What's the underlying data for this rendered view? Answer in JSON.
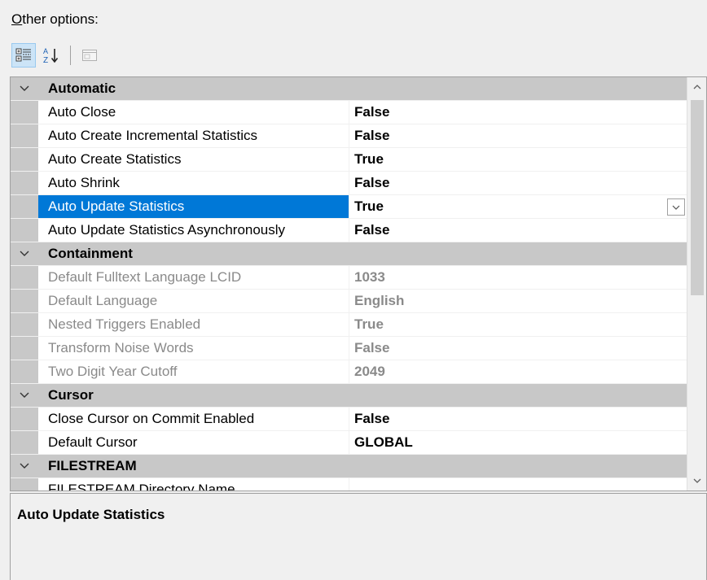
{
  "header": {
    "label_first": "O",
    "label_rest": "ther options:"
  },
  "toolbar": {
    "categorized_icon": "categorized-icon",
    "alphabetical_icon": "alphabetical-icon",
    "property_pages_icon": "property-pages-icon"
  },
  "categories": [
    {
      "name": "Automatic",
      "rows": [
        {
          "name": "Auto Close",
          "value": "False"
        },
        {
          "name": "Auto Create Incremental Statistics",
          "value": "False"
        },
        {
          "name": "Auto Create Statistics",
          "value": "True"
        },
        {
          "name": "Auto Shrink",
          "value": "False"
        },
        {
          "name": "Auto Update Statistics",
          "value": "True"
        },
        {
          "name": "Auto Update Statistics Asynchronously",
          "value": "False"
        }
      ]
    },
    {
      "name": "Containment",
      "rows": [
        {
          "name": "Default Fulltext Language LCID",
          "value": "1033"
        },
        {
          "name": "Default Language",
          "value": "English"
        },
        {
          "name": "Nested Triggers Enabled",
          "value": "True"
        },
        {
          "name": "Transform Noise Words",
          "value": "False"
        },
        {
          "name": "Two Digit Year Cutoff",
          "value": "2049"
        }
      ]
    },
    {
      "name": "Cursor",
      "rows": [
        {
          "name": "Close Cursor on Commit Enabled",
          "value": "False"
        },
        {
          "name": "Default Cursor",
          "value": "GLOBAL"
        }
      ]
    },
    {
      "name": "FILESTREAM",
      "rows": [
        {
          "name": "FILESTREAM Directory Name",
          "value": ""
        }
      ]
    }
  ],
  "description": {
    "title": "Auto Update Statistics"
  }
}
